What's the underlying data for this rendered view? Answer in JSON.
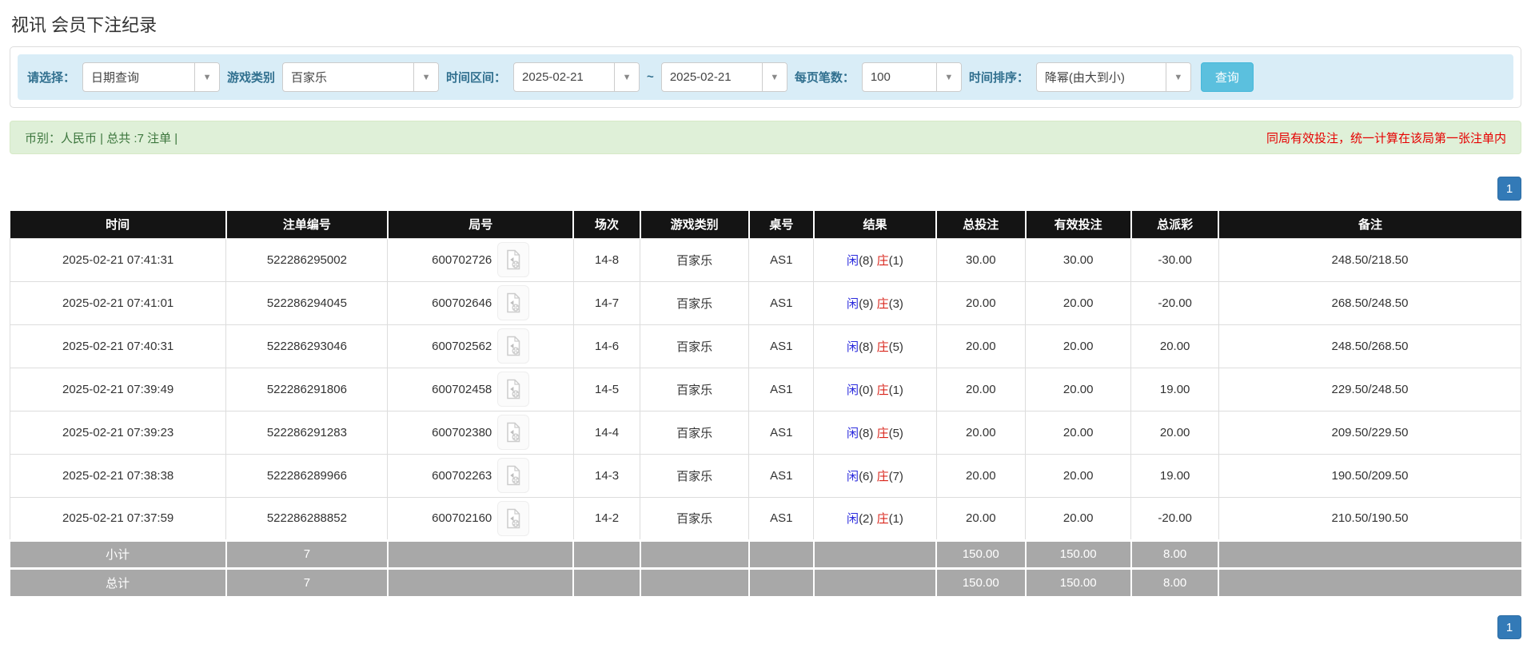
{
  "page": {
    "title": "视讯 会员下注纪录"
  },
  "filters": {
    "select_label": "请选择：",
    "select_value": "日期查询",
    "game_type_label": "游戏类别",
    "game_type_value": "百家乐",
    "date_range_label": "时间区间：",
    "date_from": "2025-02-21",
    "tilde": "~",
    "date_to": "2025-02-21",
    "page_size_label": "每页笔数：",
    "page_size_value": "100",
    "sort_label": "时间排序：",
    "sort_value": "降幂(由大到小)",
    "search_button": "查询"
  },
  "summary_bar": {
    "left_text": "币别：人民币 | 总共 :7 注单 |",
    "right_text": "同局有效投注，统一计算在该局第一张注单内"
  },
  "pagination": {
    "page": "1"
  },
  "icons": {
    "dropdown_caret": "▼",
    "video_icon_name": "video-file-icon"
  },
  "table": {
    "headers": [
      "时间",
      "注单编号",
      "局号",
      "场次",
      "游戏类别",
      "桌号",
      "结果",
      "总投注",
      "有效投注",
      "总派彩",
      "备注"
    ],
    "rows": [
      {
        "time": "2025-02-21 07:41:31",
        "bet_id": "522286295002",
        "round_id": "600702726",
        "session": "14-8",
        "game": "百家乐",
        "table_no": "AS1",
        "result_player": "闲",
        "result_player_n": "(8)",
        "result_banker": "庄",
        "result_banker_n": "(1)",
        "total_bet": "30.00",
        "valid_bet": "30.00",
        "payout": "-30.00",
        "note": "248.50/218.50"
      },
      {
        "time": "2025-02-21 07:41:01",
        "bet_id": "522286294045",
        "round_id": "600702646",
        "session": "14-7",
        "game": "百家乐",
        "table_no": "AS1",
        "result_player": "闲",
        "result_player_n": "(9)",
        "result_banker": "庄",
        "result_banker_n": "(3)",
        "total_bet": "20.00",
        "valid_bet": "20.00",
        "payout": "-20.00",
        "note": "268.50/248.50"
      },
      {
        "time": "2025-02-21 07:40:31",
        "bet_id": "522286293046",
        "round_id": "600702562",
        "session": "14-6",
        "game": "百家乐",
        "table_no": "AS1",
        "result_player": "闲",
        "result_player_n": "(8)",
        "result_banker": "庄",
        "result_banker_n": "(5)",
        "total_bet": "20.00",
        "valid_bet": "20.00",
        "payout": "20.00",
        "note": "248.50/268.50"
      },
      {
        "time": "2025-02-21 07:39:49",
        "bet_id": "522286291806",
        "round_id": "600702458",
        "session": "14-5",
        "game": "百家乐",
        "table_no": "AS1",
        "result_player": "闲",
        "result_player_n": "(0)",
        "result_banker": "庄",
        "result_banker_n": "(1)",
        "total_bet": "20.00",
        "valid_bet": "20.00",
        "payout": "19.00",
        "note": "229.50/248.50"
      },
      {
        "time": "2025-02-21 07:39:23",
        "bet_id": "522286291283",
        "round_id": "600702380",
        "session": "14-4",
        "game": "百家乐",
        "table_no": "AS1",
        "result_player": "闲",
        "result_player_n": "(8)",
        "result_banker": "庄",
        "result_banker_n": "(5)",
        "total_bet": "20.00",
        "valid_bet": "20.00",
        "payout": "20.00",
        "note": "209.50/229.50"
      },
      {
        "time": "2025-02-21 07:38:38",
        "bet_id": "522286289966",
        "round_id": "600702263",
        "session": "14-3",
        "game": "百家乐",
        "table_no": "AS1",
        "result_player": "闲",
        "result_player_n": "(6)",
        "result_banker": "庄",
        "result_banker_n": "(7)",
        "total_bet": "20.00",
        "valid_bet": "20.00",
        "payout": "19.00",
        "note": "190.50/209.50"
      },
      {
        "time": "2025-02-21 07:37:59",
        "bet_id": "522286288852",
        "round_id": "600702160",
        "session": "14-2",
        "game": "百家乐",
        "table_no": "AS1",
        "result_player": "闲",
        "result_player_n": "(2)",
        "result_banker": "庄",
        "result_banker_n": "(1)",
        "total_bet": "20.00",
        "valid_bet": "20.00",
        "payout": "-20.00",
        "note": "210.50/190.50"
      }
    ],
    "subtotal": {
      "label": "小计",
      "count": "7",
      "total_bet": "150.00",
      "valid_bet": "150.00",
      "payout": "8.00"
    },
    "total": {
      "label": "总计",
      "count": "7",
      "total_bet": "150.00",
      "valid_bet": "150.00",
      "payout": "8.00"
    }
  },
  "colors": {
    "filter_bar_bg": "#d9edf7",
    "filter_label": "#31708f",
    "search_btn_bg": "#5bc0de",
    "green_bg": "#dff0d8",
    "green_text": "#3c763d",
    "warn_red": "#e60000",
    "header_bg": "#141414",
    "summary_bg": "#a8a8a8",
    "page_btn_bg": "#337ab7",
    "bet_blue": "#1e90ff",
    "loss_red": "#ff0000",
    "player_blue": "#2b2bdd",
    "banker_red": "#d9261c"
  }
}
